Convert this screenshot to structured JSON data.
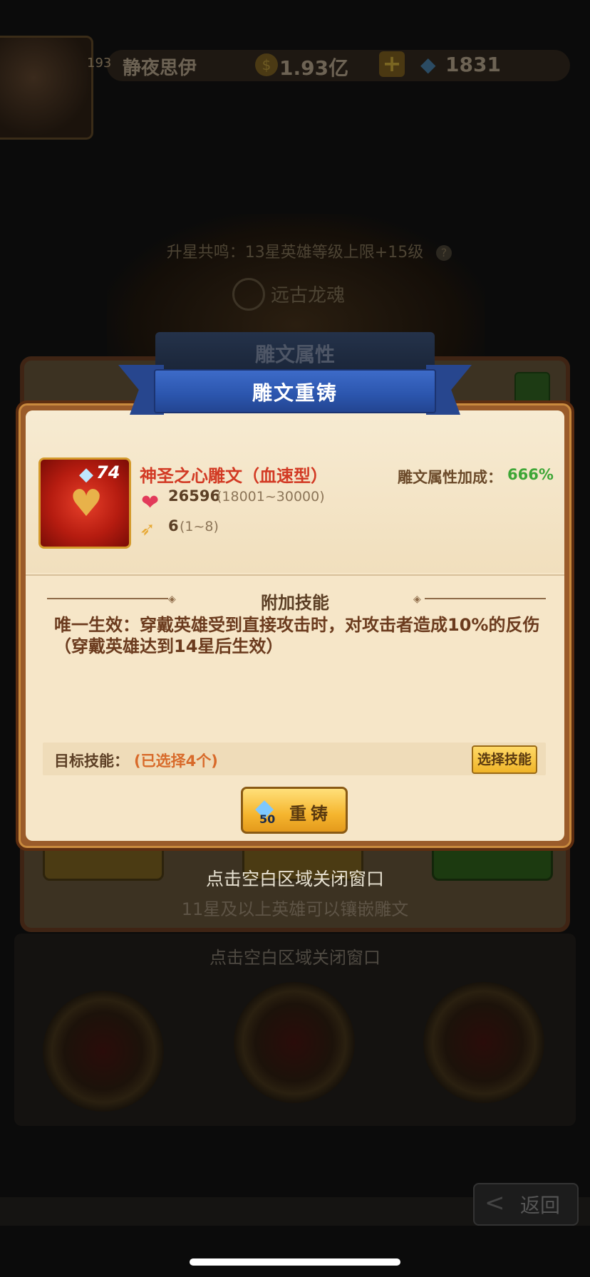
{
  "header": {
    "level": "193",
    "player_name": "静夜思伊",
    "coins": "1.93亿",
    "plus_icon": "plus-icon",
    "gems": "1831"
  },
  "background": {
    "resonance_text": "升星共鸣：13星英雄等级上限+15级",
    "soul_label": "远古龙魂",
    "panel_title": "雕文属性",
    "inlay_hint": "11星及以上英雄可以镶嵌雕文",
    "close_hint_lower": "点击空白区域关闭窗口",
    "back_label": "返回"
  },
  "modal": {
    "title": "雕文重铸",
    "rune": {
      "level": "74",
      "name": "神圣之心雕文（血速型）",
      "bonus_label": "雕文属性加成：",
      "bonus_value": "666%",
      "hp_value": "26596",
      "hp_range": "(18001~30000)",
      "speed_value": "6",
      "speed_range": "(1~8)"
    },
    "section_title": "附加技能",
    "skill_desc": "唯一生效：穿戴英雄受到直接攻击时，对攻击者造成10%的反伤（穿戴英雄达到14星后生效）",
    "target_label": "目标技能：",
    "target_value": "(已选择4个)",
    "select_button": "选择技能",
    "recast_cost": "50",
    "recast_label": "重铸"
  },
  "close_hint": "点击空白区域关闭窗口",
  "colors": {
    "title_ribbon": "#2b55ad",
    "rune_name": "#d23a24",
    "bonus_green": "#3da636",
    "button_gold": "#f5b52e"
  }
}
